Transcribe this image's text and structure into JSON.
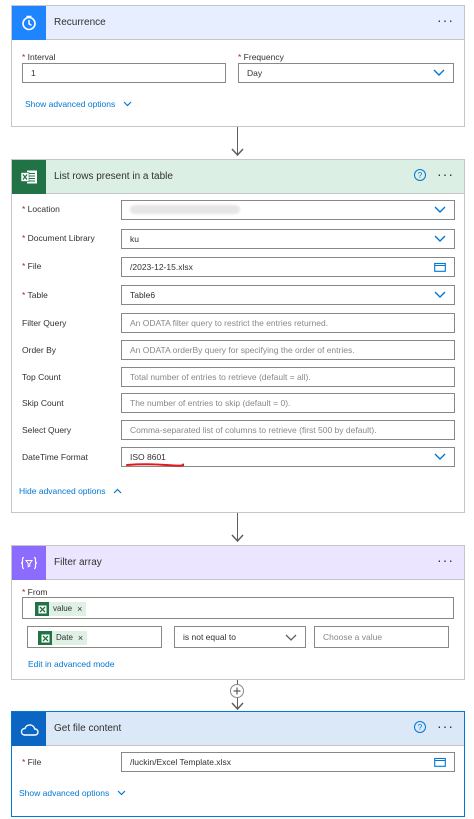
{
  "recurrence": {
    "title": "Recurrence",
    "more": "···",
    "interval_label": "Interval",
    "interval_value": "1",
    "frequency_label": "Frequency",
    "frequency_value": "Day",
    "advanced_link": "Show advanced options"
  },
  "list_rows": {
    "title": "List rows present in a table",
    "help": "?",
    "more": "···",
    "fields": {
      "location": {
        "label": "Location",
        "value": ""
      },
      "document_library": {
        "label": "Document Library",
        "value": "ku"
      },
      "file": {
        "label": "File",
        "value": "/2023-12-15.xlsx"
      },
      "table": {
        "label": "Table",
        "value": "Table6"
      },
      "filter_query": {
        "label": "Filter Query",
        "placeholder": "An ODATA filter query to restrict the entries returned."
      },
      "order_by": {
        "label": "Order By",
        "placeholder": "An ODATA orderBy query for specifying the order of entries."
      },
      "top_count": {
        "label": "Top Count",
        "placeholder": "Total number of entries to retrieve (default = all)."
      },
      "skip_count": {
        "label": "Skip Count",
        "placeholder": "The number of entries to skip (default = 0)."
      },
      "select_query": {
        "label": "Select Query",
        "placeholder": "Comma-separated list of columns to retrieve (first 500 by default)."
      },
      "datetime_format": {
        "label": "DateTime Format",
        "value": "ISO 8601"
      }
    },
    "advanced_link": "Hide advanced options"
  },
  "filter_array": {
    "title": "Filter array",
    "more": "···",
    "from_label": "From",
    "from_token": "value",
    "left_token": "Date",
    "operator": "is not equal to",
    "right_placeholder": "Choose a value",
    "advanced_link": "Edit in advanced mode"
  },
  "get_file": {
    "title": "Get file content",
    "help": "?",
    "more": "···",
    "file_label": "File",
    "file_value": "/luckin/Excel Template.xlsx",
    "advanced_link": "Show advanced options"
  },
  "colors": {
    "recurrence_accent": "#1f85ff",
    "excel_green": "#217346",
    "excel_header": "#dcefe4",
    "filter_purple": "#8c6cff",
    "filter_header": "#ece5ff",
    "onedrive_blue": "#0a66c2",
    "annotation_red": "#e0191c"
  }
}
